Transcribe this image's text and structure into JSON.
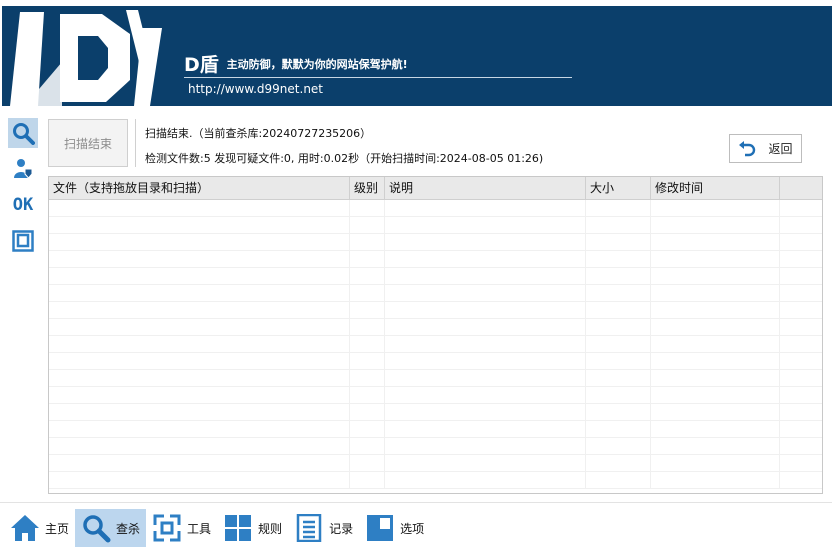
{
  "header": {
    "brand_name": "D盾",
    "slogan": "主动防御，默默为你的网站保驾护航!",
    "url": "http://www.d99net.net",
    "colors": {
      "banner": "#0b3f6b",
      "text": "#ffffff"
    }
  },
  "left_toolbar": [
    {
      "icon": "search-icon",
      "active": true
    },
    {
      "icon": "user-shield-icon",
      "active": false
    },
    {
      "icon": "ok-icon",
      "text": "OK",
      "active": false
    },
    {
      "icon": "frame-icon",
      "active": false
    }
  ],
  "scan": {
    "button_label": "扫描结束",
    "status_line1": "扫描结束.（当前查杀库:20240727235206）",
    "status_line2": "检测文件数:5 发现可疑文件:0, 用时:0.02秒（开始扫描时间:2024-08-05 01:26)",
    "back_label": "返回"
  },
  "table": {
    "columns": [
      "文件（支持拖放目录和扫描）",
      "级别",
      "说明",
      "大小",
      "修改时间",
      ""
    ],
    "rows": []
  },
  "nav": [
    {
      "label": "主页",
      "icon": "home-icon",
      "active": false
    },
    {
      "label": "查杀",
      "icon": "search-icon",
      "active": true
    },
    {
      "label": "工具",
      "icon": "tools-icon",
      "active": false
    },
    {
      "label": "规则",
      "icon": "grid-icon",
      "active": false
    },
    {
      "label": "记录",
      "icon": "log-icon",
      "active": false
    },
    {
      "label": "选项",
      "icon": "options-icon",
      "active": false
    }
  ],
  "accent_color": "#2e7fc4"
}
